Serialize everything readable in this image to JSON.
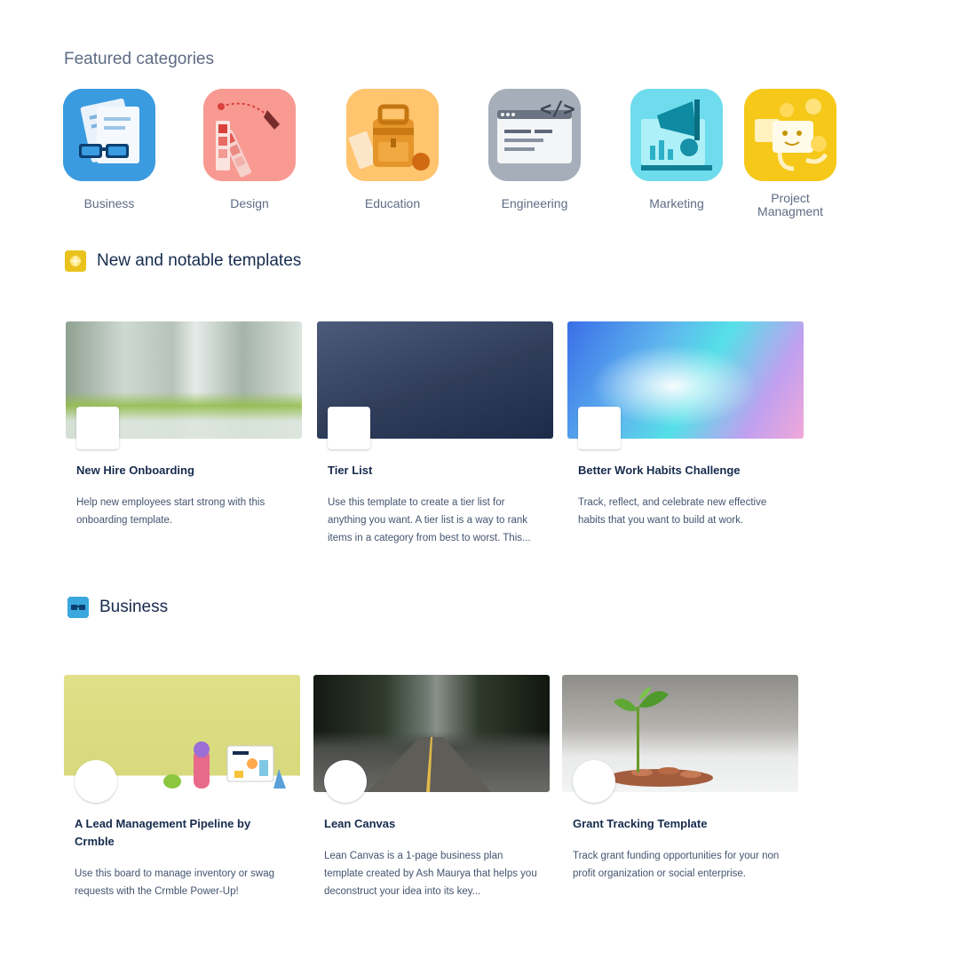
{
  "featured": {
    "title": "Featured categories",
    "categories": [
      {
        "label": "Business",
        "icon": "business-icon",
        "color": "#2b8ed8"
      },
      {
        "label": "Design",
        "icon": "design-icon",
        "color": "#f88b86"
      },
      {
        "label": "Education",
        "icon": "education-icon",
        "color": "#ffb85c"
      },
      {
        "label": "Engineering",
        "icon": "engineering-icon",
        "color": "#9aa3b0"
      },
      {
        "label": "Marketing",
        "icon": "marketing-icon",
        "color": "#5ad4e6"
      },
      {
        "label": "Project\nManagment",
        "icon": "project-management-icon",
        "color": "#f2c20a"
      }
    ]
  },
  "new_notable": {
    "heading": "New and notable templates",
    "icon": "sparkle-icon",
    "cards": [
      {
        "title": "New Hire Onboarding",
        "description": "Help new employees start strong with this onboarding template."
      },
      {
        "title": "Tier List",
        "description": "Use this template to create a tier list for anything you want. A tier list is a way to rank items in a category from best to worst. This..."
      },
      {
        "title": "Better Work Habits Challenge",
        "description": "Track, reflect, and celebrate new effective habits that you want to build at work."
      }
    ]
  },
  "business": {
    "heading": "Business",
    "icon": "glasses-icon",
    "cards": [
      {
        "title": "A Lead Management Pipeline by Crmble",
        "description": "Use this board to manage inventory or swag requests with the Crmble Power-Up!"
      },
      {
        "title": "Lean Canvas",
        "description": "Lean Canvas is a 1-page business plan template created by Ash Maurya that helps you deconstruct your idea into its key..."
      },
      {
        "title": "Grant Tracking Template",
        "description": "Track grant funding opportunities for your non profit organization or social enterprise."
      }
    ]
  }
}
